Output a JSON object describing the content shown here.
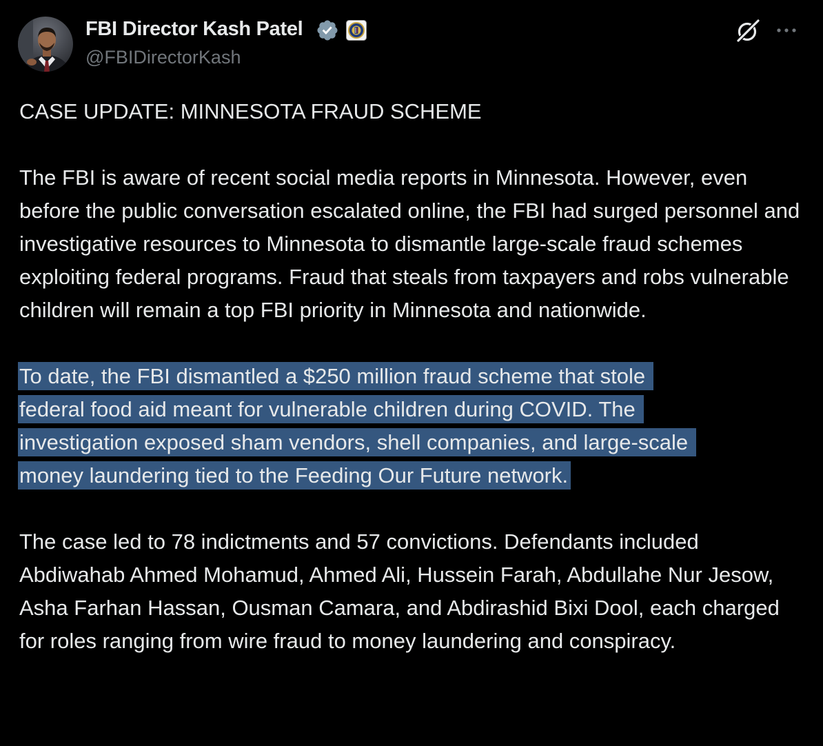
{
  "author": {
    "display_name": "FBI Director Kash Patel",
    "handle": "@FBIDirectorKash",
    "avatar_icon": "profile-photo",
    "verified_icon": "verified-badge-icon",
    "affiliate_icon": "fbi-seal-icon"
  },
  "actions": {
    "grok_icon": "grok-icon",
    "more_icon": "more-options-icon"
  },
  "post": {
    "heading": "CASE UPDATE: MINNESOTA FRAUD SCHEME",
    "paragraph_1": "The FBI is aware of recent social media reports in Minnesota. However, even before the public conversation escalated online, the FBI had surged personnel and investigative resources to Minnesota to dismantle large-scale fraud schemes exploiting federal programs. Fraud that steals from taxpayers and robs vulnerable children will remain a top FBI priority in Minnesota and nationwide.",
    "highlighted_lines": [
      "To date, the FBI dismantled a $250 million fraud scheme that stole",
      "federal food aid meant for vulnerable children during COVID. The",
      "investigation exposed sham vendors, shell companies, and large-scale",
      "money laundering tied to the Feeding Our Future network."
    ],
    "paragraph_3": "The case led to 78 indictments and 57 convictions. Defendants included Abdiwahab Ahmed Mohamud, Ahmed Ali, Hussein Farah, Abdullahe Nur Jesow, Asha Farhan Hassan, Ousman Camara, and Abdirashid Bixi Dool, each charged for roles ranging from wire fraud to money laundering and conspiracy."
  },
  "colors": {
    "background": "#000000",
    "text": "#e7e9ea",
    "secondary_text": "#71767b",
    "selection_highlight": "#35577f",
    "verified": "#1d9bf0"
  }
}
